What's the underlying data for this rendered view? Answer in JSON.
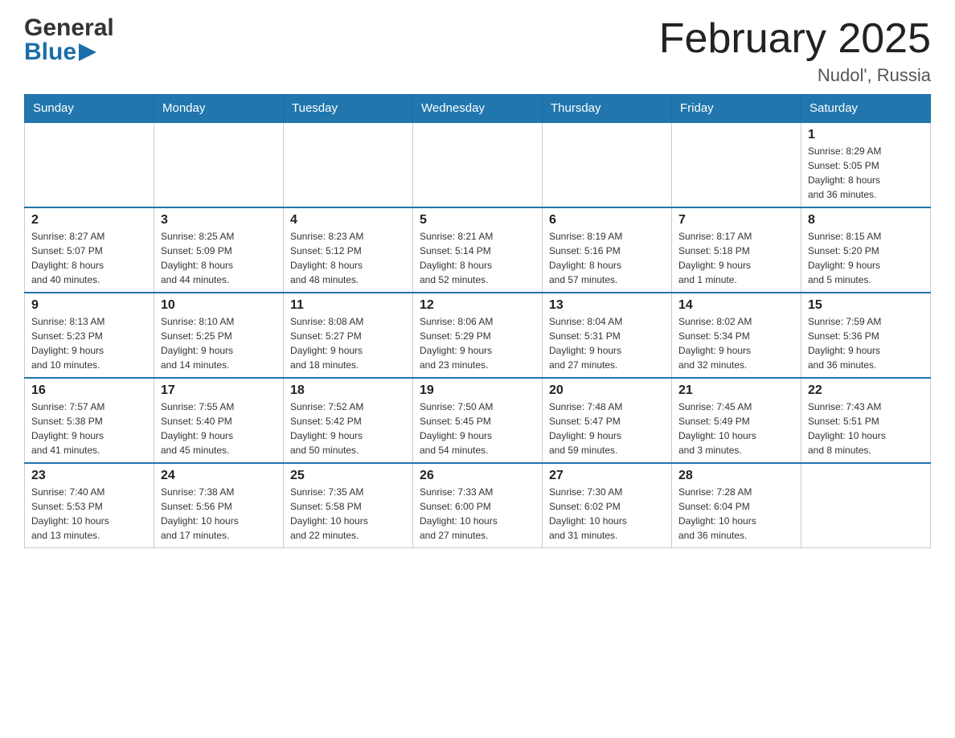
{
  "header": {
    "logo_line1": "General",
    "logo_line2": "Blue",
    "month_title": "February 2025",
    "location": "Nudol', Russia"
  },
  "days_of_week": [
    "Sunday",
    "Monday",
    "Tuesday",
    "Wednesday",
    "Thursday",
    "Friday",
    "Saturday"
  ],
  "weeks": [
    {
      "days": [
        {
          "number": "",
          "info": "",
          "empty": true
        },
        {
          "number": "",
          "info": "",
          "empty": true
        },
        {
          "number": "",
          "info": "",
          "empty": true
        },
        {
          "number": "",
          "info": "",
          "empty": true
        },
        {
          "number": "",
          "info": "",
          "empty": true
        },
        {
          "number": "",
          "info": "",
          "empty": true
        },
        {
          "number": "1",
          "info": "Sunrise: 8:29 AM\nSunset: 5:05 PM\nDaylight: 8 hours\nand 36 minutes.",
          "empty": false
        }
      ]
    },
    {
      "days": [
        {
          "number": "2",
          "info": "Sunrise: 8:27 AM\nSunset: 5:07 PM\nDaylight: 8 hours\nand 40 minutes.",
          "empty": false
        },
        {
          "number": "3",
          "info": "Sunrise: 8:25 AM\nSunset: 5:09 PM\nDaylight: 8 hours\nand 44 minutes.",
          "empty": false
        },
        {
          "number": "4",
          "info": "Sunrise: 8:23 AM\nSunset: 5:12 PM\nDaylight: 8 hours\nand 48 minutes.",
          "empty": false
        },
        {
          "number": "5",
          "info": "Sunrise: 8:21 AM\nSunset: 5:14 PM\nDaylight: 8 hours\nand 52 minutes.",
          "empty": false
        },
        {
          "number": "6",
          "info": "Sunrise: 8:19 AM\nSunset: 5:16 PM\nDaylight: 8 hours\nand 57 minutes.",
          "empty": false
        },
        {
          "number": "7",
          "info": "Sunrise: 8:17 AM\nSunset: 5:18 PM\nDaylight: 9 hours\nand 1 minute.",
          "empty": false
        },
        {
          "number": "8",
          "info": "Sunrise: 8:15 AM\nSunset: 5:20 PM\nDaylight: 9 hours\nand 5 minutes.",
          "empty": false
        }
      ]
    },
    {
      "days": [
        {
          "number": "9",
          "info": "Sunrise: 8:13 AM\nSunset: 5:23 PM\nDaylight: 9 hours\nand 10 minutes.",
          "empty": false
        },
        {
          "number": "10",
          "info": "Sunrise: 8:10 AM\nSunset: 5:25 PM\nDaylight: 9 hours\nand 14 minutes.",
          "empty": false
        },
        {
          "number": "11",
          "info": "Sunrise: 8:08 AM\nSunset: 5:27 PM\nDaylight: 9 hours\nand 18 minutes.",
          "empty": false
        },
        {
          "number": "12",
          "info": "Sunrise: 8:06 AM\nSunset: 5:29 PM\nDaylight: 9 hours\nand 23 minutes.",
          "empty": false
        },
        {
          "number": "13",
          "info": "Sunrise: 8:04 AM\nSunset: 5:31 PM\nDaylight: 9 hours\nand 27 minutes.",
          "empty": false
        },
        {
          "number": "14",
          "info": "Sunrise: 8:02 AM\nSunset: 5:34 PM\nDaylight: 9 hours\nand 32 minutes.",
          "empty": false
        },
        {
          "number": "15",
          "info": "Sunrise: 7:59 AM\nSunset: 5:36 PM\nDaylight: 9 hours\nand 36 minutes.",
          "empty": false
        }
      ]
    },
    {
      "days": [
        {
          "number": "16",
          "info": "Sunrise: 7:57 AM\nSunset: 5:38 PM\nDaylight: 9 hours\nand 41 minutes.",
          "empty": false
        },
        {
          "number": "17",
          "info": "Sunrise: 7:55 AM\nSunset: 5:40 PM\nDaylight: 9 hours\nand 45 minutes.",
          "empty": false
        },
        {
          "number": "18",
          "info": "Sunrise: 7:52 AM\nSunset: 5:42 PM\nDaylight: 9 hours\nand 50 minutes.",
          "empty": false
        },
        {
          "number": "19",
          "info": "Sunrise: 7:50 AM\nSunset: 5:45 PM\nDaylight: 9 hours\nand 54 minutes.",
          "empty": false
        },
        {
          "number": "20",
          "info": "Sunrise: 7:48 AM\nSunset: 5:47 PM\nDaylight: 9 hours\nand 59 minutes.",
          "empty": false
        },
        {
          "number": "21",
          "info": "Sunrise: 7:45 AM\nSunset: 5:49 PM\nDaylight: 10 hours\nand 3 minutes.",
          "empty": false
        },
        {
          "number": "22",
          "info": "Sunrise: 7:43 AM\nSunset: 5:51 PM\nDaylight: 10 hours\nand 8 minutes.",
          "empty": false
        }
      ]
    },
    {
      "days": [
        {
          "number": "23",
          "info": "Sunrise: 7:40 AM\nSunset: 5:53 PM\nDaylight: 10 hours\nand 13 minutes.",
          "empty": false
        },
        {
          "number": "24",
          "info": "Sunrise: 7:38 AM\nSunset: 5:56 PM\nDaylight: 10 hours\nand 17 minutes.",
          "empty": false
        },
        {
          "number": "25",
          "info": "Sunrise: 7:35 AM\nSunset: 5:58 PM\nDaylight: 10 hours\nand 22 minutes.",
          "empty": false
        },
        {
          "number": "26",
          "info": "Sunrise: 7:33 AM\nSunset: 6:00 PM\nDaylight: 10 hours\nand 27 minutes.",
          "empty": false
        },
        {
          "number": "27",
          "info": "Sunrise: 7:30 AM\nSunset: 6:02 PM\nDaylight: 10 hours\nand 31 minutes.",
          "empty": false
        },
        {
          "number": "28",
          "info": "Sunrise: 7:28 AM\nSunset: 6:04 PM\nDaylight: 10 hours\nand 36 minutes.",
          "empty": false
        },
        {
          "number": "",
          "info": "",
          "empty": true
        }
      ]
    }
  ]
}
